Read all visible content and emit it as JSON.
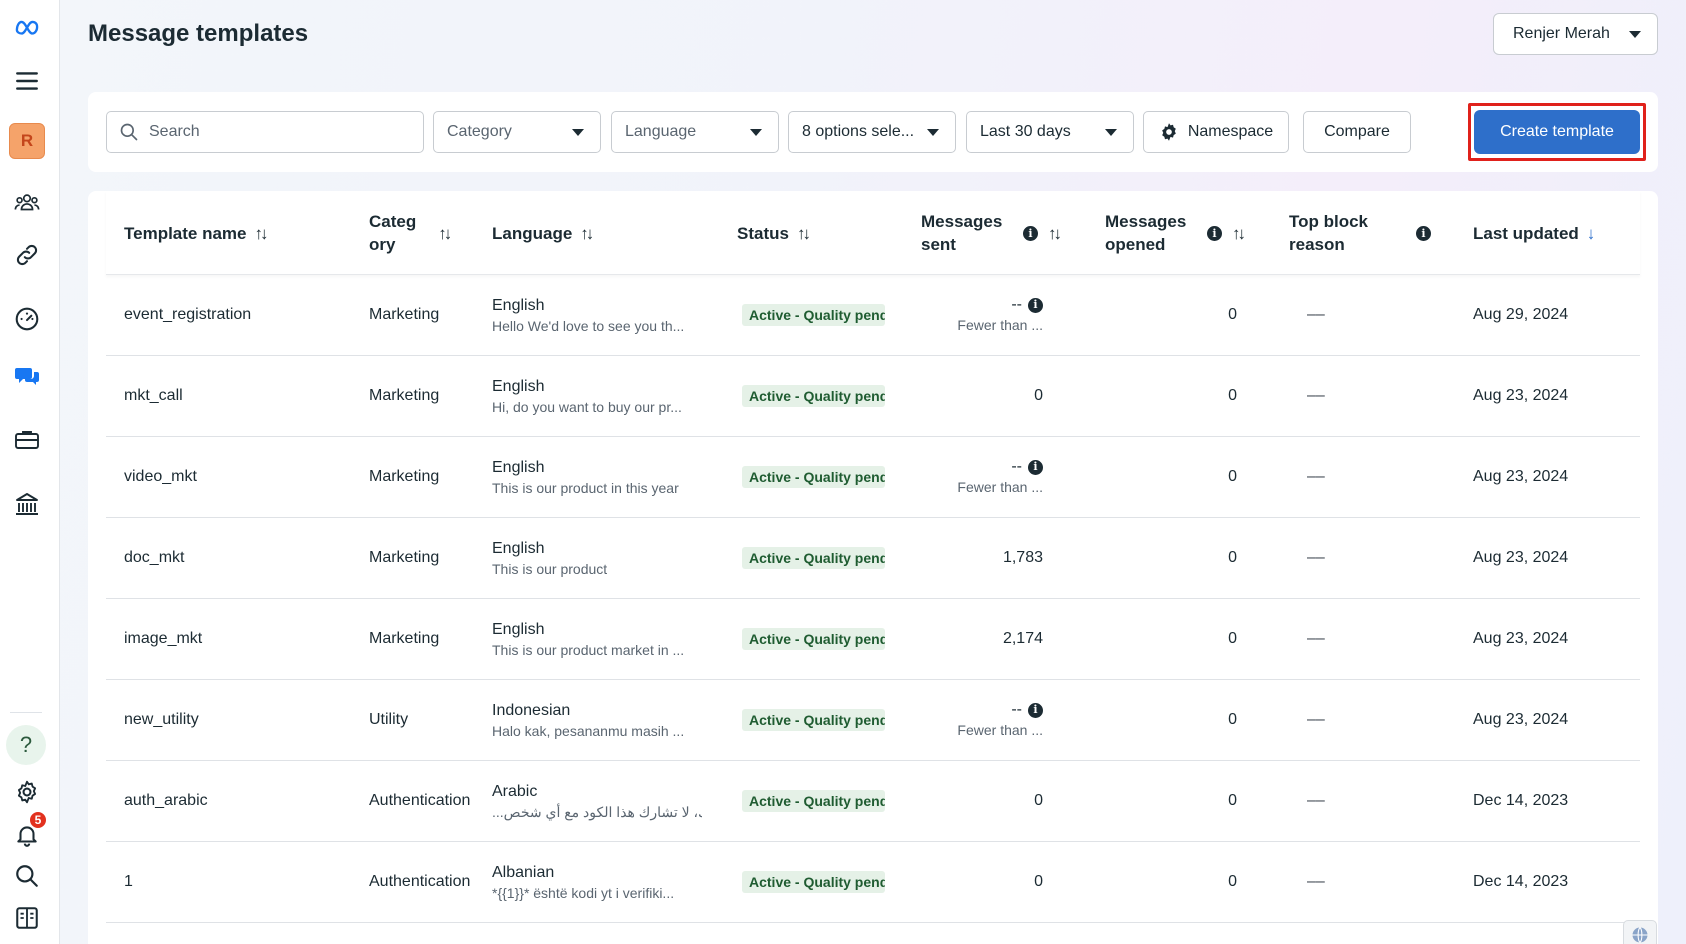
{
  "header": {
    "title": "Message templates",
    "account_name": "Renjer Merah"
  },
  "rail": {
    "avatar_letter": "R",
    "notification_count": "5",
    "help_label": "?"
  },
  "filters": {
    "search_placeholder": "Search",
    "category": "Category",
    "language": "Language",
    "status": "8 options sele...",
    "date_range": "Last 30 days",
    "namespace": "Namespace",
    "compare": "Compare",
    "create": "Create template"
  },
  "columns": {
    "template_name": "Template name",
    "category_line1": "Categ",
    "category_line2": "ory",
    "language": "Language",
    "status": "Status",
    "sent_line1": "Messages",
    "sent_line2": "sent",
    "opened_line1": "Messages",
    "opened_line2": "opened",
    "block_line1": "Top block",
    "block_line2": "reason",
    "last_updated": "Last updated"
  },
  "rows": [
    {
      "name": "event_registration",
      "category": "Marketing",
      "language": "English",
      "preview": "Hello We'd love to see you th...",
      "status": "Active - Quality pending",
      "sent": "--",
      "sent_sub": "Fewer than ...",
      "opened": "0",
      "block": "––",
      "updated": "Aug 29, 2024"
    },
    {
      "name": "mkt_call",
      "category": "Marketing",
      "language": "English",
      "preview": "Hi, do you want to buy our pr...",
      "status": "Active - Quality pending",
      "sent": "0",
      "sent_sub": "",
      "opened": "0",
      "block": "––",
      "updated": "Aug 23, 2024"
    },
    {
      "name": "video_mkt",
      "category": "Marketing",
      "language": "English",
      "preview": "This is our product in this year",
      "status": "Active - Quality pending",
      "sent": "--",
      "sent_sub": "Fewer than ...",
      "opened": "0",
      "block": "––",
      "updated": "Aug 23, 2024"
    },
    {
      "name": "doc_mkt",
      "category": "Marketing",
      "language": "English",
      "preview": "This is our product",
      "status": "Active - Quality pending",
      "sent": "1,783",
      "sent_sub": "",
      "opened": "0",
      "block": "––",
      "updated": "Aug 23, 2024"
    },
    {
      "name": "image_mkt",
      "category": "Marketing",
      "language": "English",
      "preview": "This is our product market in ...",
      "status": "Active - Quality pending",
      "sent": "2,174",
      "sent_sub": "",
      "opened": "0",
      "block": "––",
      "updated": "Aug 23, 2024"
    },
    {
      "name": "new_utility",
      "category": "Utility",
      "language": "Indonesian",
      "preview": "Halo kak, pesananmu masih ...",
      "status": "Active - Quality pending",
      "sent": "--",
      "sent_sub": "Fewer than ...",
      "opened": "0",
      "block": "––",
      "updated": "Aug 23, 2024"
    },
    {
      "name": "auth_arabic",
      "category": "Authentication",
      "language": "Arabic",
      "preview": "...ى أمانك، لا تشارك هذا الكود مع أي شخص",
      "status": "Active - Quality pending",
      "sent": "0",
      "sent_sub": "",
      "opened": "0",
      "block": "––",
      "updated": "Dec 14, 2023"
    },
    {
      "name": "1",
      "category": "Authentication",
      "language": "Albanian",
      "preview": "*{{1}}* është kodi yt i verifiki...",
      "status": "Active - Quality pending",
      "sent": "0",
      "sent_sub": "",
      "opened": "0",
      "block": "––",
      "updated": "Dec 14, 2023"
    }
  ],
  "colors": {
    "primary": "#2e6fca",
    "highlight_outline": "#e0211b",
    "status_bg": "#e5f1e7",
    "status_text": "#1f5c31"
  }
}
